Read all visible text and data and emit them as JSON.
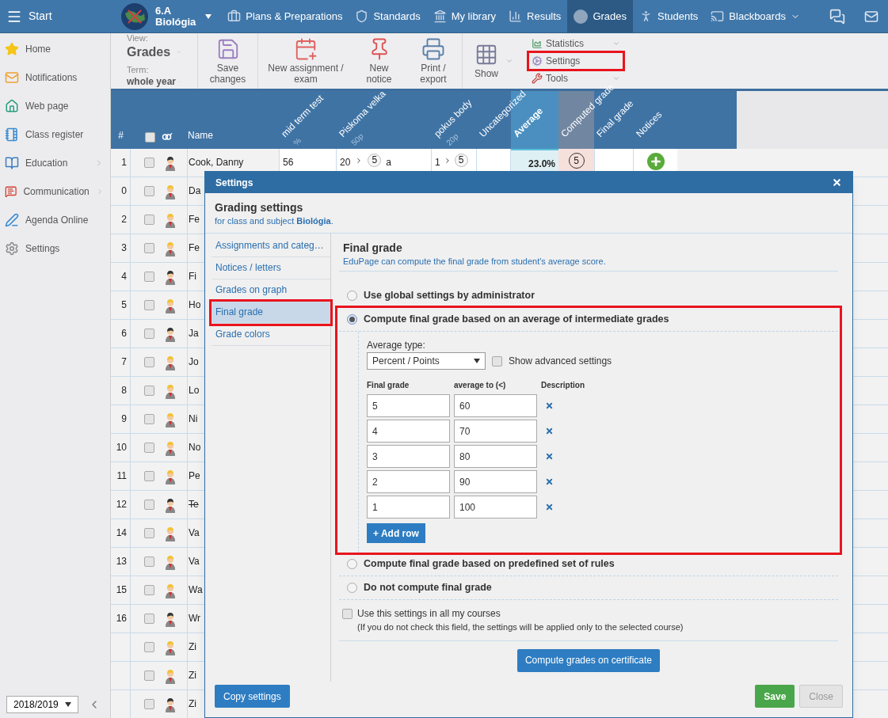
{
  "topbar": {
    "start": "Start",
    "class_name": "6.A",
    "subject": "Biológia",
    "nav": [
      {
        "label": "Plans & Preparations",
        "selected": false,
        "dropdown": false
      },
      {
        "label": "Standards",
        "selected": false,
        "dropdown": false
      },
      {
        "label": "My library",
        "selected": false,
        "dropdown": false
      },
      {
        "label": "Results",
        "selected": false,
        "dropdown": false
      },
      {
        "label": "Grades",
        "selected": true,
        "dropdown": false
      },
      {
        "label": "Students",
        "selected": false,
        "dropdown": false
      },
      {
        "label": "Blackboards",
        "selected": false,
        "dropdown": true
      }
    ]
  },
  "sidebar": {
    "items": [
      {
        "label": "Home",
        "submenu": false
      },
      {
        "label": "Notifications",
        "submenu": false
      },
      {
        "label": "Web page",
        "submenu": false
      },
      {
        "label": "Class register",
        "submenu": false
      },
      {
        "label": "Education",
        "submenu": true
      },
      {
        "label": "Communication",
        "submenu": true
      },
      {
        "label": "Agenda Online",
        "submenu": false
      },
      {
        "label": "Settings",
        "submenu": false
      }
    ],
    "year": "2018/2019"
  },
  "toolbar": {
    "view_label": "View:",
    "view": "Grades",
    "term_label": "Term:",
    "term": "whole year",
    "buttons": [
      {
        "label": "Save changes"
      },
      {
        "label": "New assignment / exam"
      },
      {
        "label": "New notice"
      },
      {
        "label": "Print / export"
      },
      {
        "label": "Show"
      }
    ],
    "menu": [
      {
        "label": "Statistics",
        "highlighted": false,
        "dropdown": true
      },
      {
        "label": "Settings",
        "highlighted": true,
        "dropdown": false
      },
      {
        "label": "Tools",
        "highlighted": false,
        "dropdown": true
      }
    ]
  },
  "table": {
    "number_heading": "#",
    "name_heading": "Name",
    "select_all_checked": false,
    "columns": [
      {
        "label": "mid term test",
        "sub": "%",
        "kind": "plain"
      },
      {
        "label": "Piskoma velka",
        "sub": "50p",
        "kind": "plain"
      },
      {
        "label": "pokus body",
        "sub": "20p",
        "kind": "plain"
      },
      {
        "label": "Uncategorized",
        "kind": "plain"
      },
      {
        "label": "Average",
        "kind": "average"
      },
      {
        "label": "Computed grade",
        "kind": "computed"
      },
      {
        "label": "Final grade",
        "kind": "plain"
      },
      {
        "label": "Notices",
        "kind": "plain"
      }
    ],
    "first_row": {
      "mid_term": "56",
      "piskoma_points": "20",
      "piskoma_grade": "5",
      "piskoma_note": "a",
      "pokus_points": "1",
      "pokus_grade": "5",
      "average": "23.0%",
      "computed": "5"
    },
    "rows": [
      {
        "number": "1",
        "name": "Cook, Danny",
        "kind": "boy",
        "checked": false,
        "struck": false
      },
      {
        "number": "0",
        "name": "Da",
        "kind": "girl",
        "checked": false,
        "struck": false
      },
      {
        "number": "2",
        "name": "Fe",
        "kind": "girl",
        "checked": false,
        "struck": false
      },
      {
        "number": "3",
        "name": "Fe",
        "kind": "girl",
        "checked": false,
        "struck": false
      },
      {
        "number": "4",
        "name": "Fi",
        "kind": "boy",
        "checked": false,
        "struck": false
      },
      {
        "number": "5",
        "name": "Ho",
        "kind": "girl",
        "checked": false,
        "struck": false
      },
      {
        "number": "6",
        "name": "Ja",
        "kind": "boy",
        "checked": false,
        "struck": false
      },
      {
        "number": "7",
        "name": "Jo",
        "kind": "girl",
        "checked": false,
        "struck": false
      },
      {
        "number": "8",
        "name": "Lo",
        "kind": "girl",
        "checked": false,
        "struck": false
      },
      {
        "number": "9",
        "name": "Ni",
        "kind": "girl",
        "checked": false,
        "struck": false
      },
      {
        "number": "10",
        "name": "No",
        "kind": "girl",
        "checked": false,
        "struck": false
      },
      {
        "number": "11",
        "name": "Pe",
        "kind": "girl",
        "checked": false,
        "struck": false
      },
      {
        "number": "12",
        "name": "Te",
        "kind": "boy",
        "checked": false,
        "struck": true
      },
      {
        "number": "14",
        "name": "Va",
        "kind": "girl",
        "checked": false,
        "struck": false
      },
      {
        "number": "13",
        "name": "Va",
        "kind": "girl",
        "checked": false,
        "struck": false
      },
      {
        "number": "15",
        "name": "Wa",
        "kind": "girl",
        "checked": false,
        "struck": false
      },
      {
        "number": "16",
        "name": "Wr",
        "kind": "boy",
        "checked": false,
        "struck": false
      },
      {
        "name": "Zi",
        "kind": "girl",
        "checked": false,
        "struck": false
      },
      {
        "name": "Zi",
        "kind": "girl",
        "checked": false,
        "struck": false
      },
      {
        "name": "Zi",
        "kind": "boy",
        "checked": false,
        "struck": false
      }
    ]
  },
  "dialog": {
    "title": "Settings",
    "heading": "Grading settings",
    "subheading": "for class and subject **Biológia**.",
    "nav": [
      {
        "label": "Assignments and categ…",
        "selected": false,
        "highlighted": false
      },
      {
        "label": "Notices / letters",
        "selected": false,
        "highlighted": false
      },
      {
        "label": "Grades on graph",
        "selected": false,
        "highlighted": false
      },
      {
        "label": "Final grade",
        "selected": true,
        "highlighted": true
      },
      {
        "label": "Grade colors",
        "selected": false,
        "highlighted": false
      }
    ],
    "section_title": "Final grade",
    "section_description": "EduPage can compute the final grade from student's average score.",
    "options": [
      {
        "label": "Use global settings by administrator",
        "selected": false,
        "highlighted": false,
        "kind": "plain"
      },
      {
        "label": "Compute final grade based on an average of intermediate grades",
        "selected": true,
        "highlighted": true,
        "kind": "average"
      },
      {
        "label": "Compute final grade based on predefined set of rules",
        "selected": false,
        "highlighted": false,
        "kind": "plain"
      },
      {
        "label": "Do not compute final grade",
        "selected": false,
        "highlighted": false,
        "kind": "plain"
      }
    ],
    "average": {
      "type_label": "Average type:",
      "type": "Percent / Points",
      "advanced_label": "Show advanced settings",
      "advanced_checked": false,
      "headings": [
        "Final grade",
        "average to (<)",
        "Description"
      ],
      "rows": [
        {
          "grade": "5",
          "average": "60"
        },
        {
          "grade": "4",
          "average": "70"
        },
        {
          "grade": "3",
          "average": "80"
        },
        {
          "grade": "2",
          "average": "90"
        },
        {
          "grade": "1",
          "average": "100"
        }
      ],
      "add_row": "+ Add row"
    },
    "all_courses_label": "Use this settings in all my courses",
    "all_courses_checked": false,
    "all_courses_note": "(If you do not check this field, the settings will be applied only to the selected course)",
    "certificate_button": "Compute grades on certificate",
    "copy_button": "Copy settings",
    "save_button": "Save",
    "close_button": "Close"
  }
}
